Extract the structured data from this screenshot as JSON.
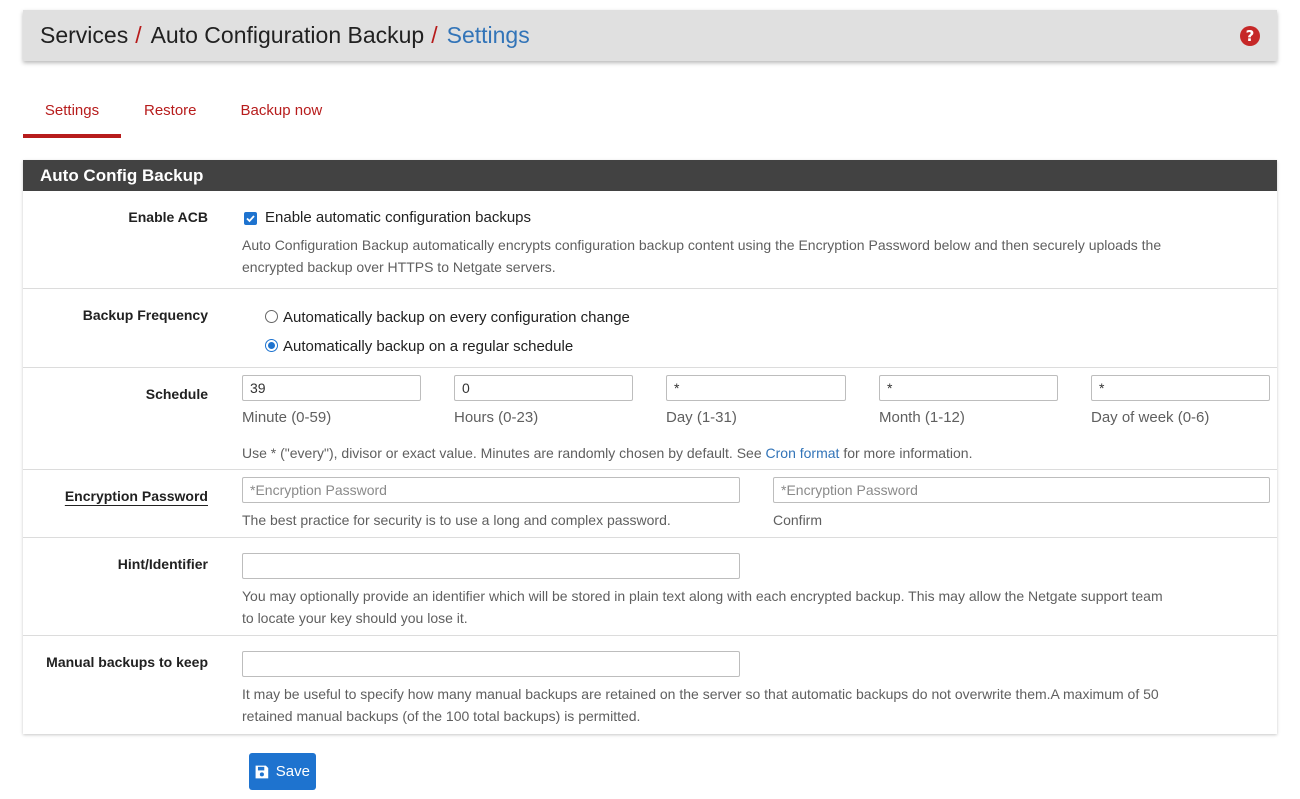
{
  "breadcrumb": {
    "items": [
      "Services",
      "Auto Configuration Backup",
      "Settings"
    ],
    "separator": "/"
  },
  "help_icon": "question-circle-icon",
  "tabs": [
    {
      "label": "Settings",
      "active": true
    },
    {
      "label": "Restore",
      "active": false
    },
    {
      "label": "Backup now",
      "active": false
    }
  ],
  "panel": {
    "title": "Auto Config Backup"
  },
  "enable_acb": {
    "label": "Enable ACB",
    "checked": true,
    "checkbox_text": "Enable automatic configuration backups",
    "help_line1": "Auto Configuration Backup automatically encrypts configuration backup content using the Encryption Password below and then securely uploads the",
    "help_line2": "encrypted backup over HTTPS to Netgate servers."
  },
  "backup_frequency": {
    "label": "Backup Frequency",
    "option1": "Automatically backup on every configuration change",
    "option2": "Automatically backup on a regular schedule",
    "selected": 2
  },
  "schedule": {
    "label": "Schedule",
    "fields": [
      {
        "value": "39",
        "label": "Minute (0-59)"
      },
      {
        "value": "0",
        "label": "Hours (0-23)"
      },
      {
        "value": "*",
        "label": "Day (1-31)"
      },
      {
        "value": "*",
        "label": "Month (1-12)"
      },
      {
        "value": "*",
        "label": "Day of week (0-6)"
      }
    ],
    "help_prefix": "Use * (\"every\"), divisor or exact value. Minutes are randomly chosen by default. See ",
    "help_link": "Cron format",
    "help_suffix": " for more information."
  },
  "encryption_password": {
    "label": "Encryption Password",
    "placeholder": "*Encryption Password",
    "confirm_placeholder": "*Encryption Password",
    "help": "The best practice for security is to use a long and complex password.",
    "confirm_label": "Confirm"
  },
  "hint": {
    "label": "Hint/Identifier",
    "value": "",
    "help_line1": "You may optionally provide an identifier which will be stored in plain text along with each encrypted backup. This may allow the Netgate support team",
    "help_line2": "to locate your key should you lose it."
  },
  "manual_backups": {
    "label": "Manual backups to keep",
    "value": "",
    "help_line1": "It may be useful to specify how many manual backups are retained on the server so that automatic backups do not overwrite them.A maximum of 50",
    "help_line2": "retained manual backups (of the 100 total backups) is permitted."
  },
  "save_button": {
    "label": "Save",
    "icon": "floppy-disk-icon"
  },
  "colors": {
    "accent_red": "#b71c1c",
    "link_blue": "#3274b8",
    "button_blue": "#1e73cf",
    "panel_heading": "#424242",
    "header_bg": "#e0e0e0"
  }
}
